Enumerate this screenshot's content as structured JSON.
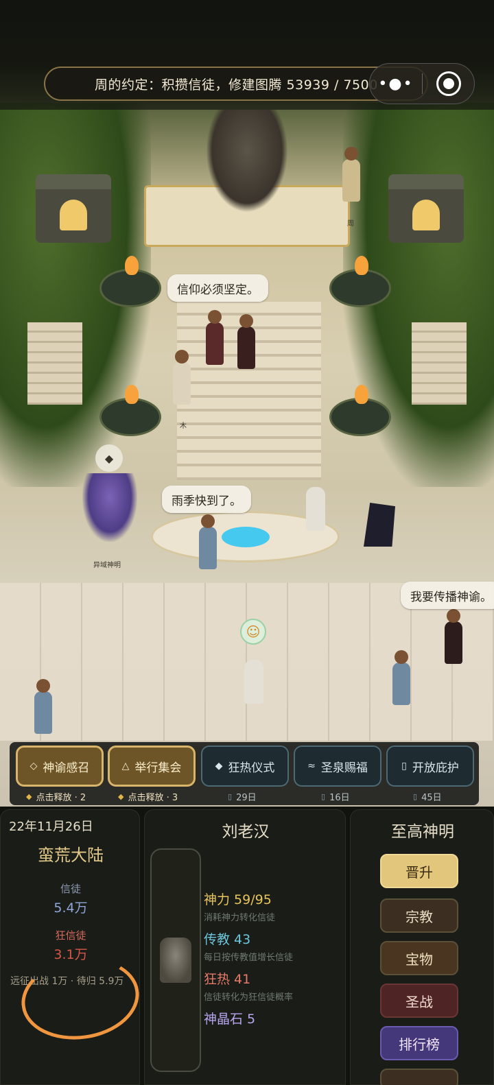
{
  "quest": {
    "text": "周的约定：积攒信徒，修建图腾  53939 / 7500",
    "current": 53939,
    "target_visible_prefix": "7500"
  },
  "capsule": {
    "more_icon": "more-dots-icon",
    "close_icon": "target-circle-icon"
  },
  "scene": {
    "bubbles": [
      "信仰必须坚定。",
      "雨季快到了。",
      "我要传播神谕。"
    ],
    "labels": {
      "alien_god": "异域神明",
      "zhou": "周",
      "mu": "木"
    },
    "squid_bubble_icon": "diamond-icon",
    "smile_bubble_icon": "smile-icon"
  },
  "actions": [
    {
      "icon": "◇",
      "label": "神谕感召",
      "sub_mark": "◆",
      "sub": "点击释放 · 2",
      "style": "gold"
    },
    {
      "icon": "△",
      "label": "举行集会",
      "sub_mark": "◆",
      "sub": "点击释放 · 3",
      "style": "gold"
    },
    {
      "icon": "◆",
      "label": "狂热仪式",
      "sub_mark": "",
      "sub": "29日",
      "style": "teal"
    },
    {
      "icon": "≈",
      "label": "圣泉赐福",
      "sub_mark": "",
      "sub": "16日",
      "style": "teal"
    },
    {
      "icon": "",
      "label": "开放庇护",
      "sub_mark": "",
      "sub": "45日",
      "style": "teal"
    }
  ],
  "left_panel": {
    "date": "22年11月26日",
    "continent": "蛮荒大陆",
    "followers_label": "信徒",
    "followers_value": "5.4万",
    "zealots_label": "狂信徒",
    "zealots_value": "3.1万",
    "expedition": "远征出战 1万 · 待归 5.9万"
  },
  "mid_panel": {
    "deity_name": "刘老汉",
    "attributes": [
      {
        "title": "神力 59/95",
        "desc": "消耗神力转化信徒",
        "color": "#e8c65a"
      },
      {
        "title": "传教 43",
        "desc": "每日按传教值增长信徒",
        "color": "#6ec6dc"
      },
      {
        "title": "狂热 41",
        "desc": "信徒转化为狂信徒概率",
        "color": "#e57a6a"
      },
      {
        "title": "神晶石 5",
        "desc": "",
        "color": "#b9a6f0"
      }
    ]
  },
  "right_panel": {
    "title": "至高神明",
    "buttons": [
      "晋升",
      "宗教",
      "宝物",
      "圣战",
      "排行榜"
    ]
  },
  "colors": {
    "gold_accent": "#d8b56a",
    "teal_border": "#4d6a74",
    "annotation_orange": "#f09640"
  }
}
